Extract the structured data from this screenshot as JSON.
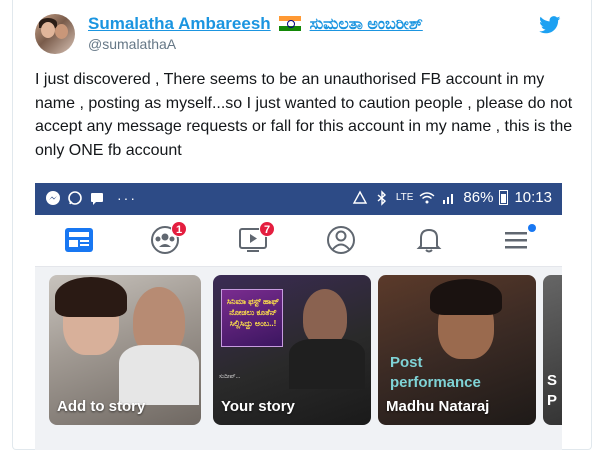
{
  "tweet": {
    "display_name": "Sumalatha Ambareesh",
    "kannada_name": "ಸುಮಲತಾ ಅಂಬರೀಶ್",
    "handle": "@sumalathaA",
    "text": "I just discovered , There seems to be an unauthorised FB account in my name , posting as myself...so I just wanted to caution people , please do not accept any message requests or fall for this account in my name , this is the  only ONE fb account"
  },
  "phone": {
    "status_bar": {
      "dots": "···",
      "network": "LTE",
      "battery_percent": "86%",
      "time": "10:13"
    },
    "nav": {
      "groups_badge": "1",
      "watch_badge": "7"
    },
    "stories": [
      {
        "label": "Add to story"
      },
      {
        "label": "Your story",
        "poster_text": "ಸಿನಿಮಾ ಫಸ್ಟ್ ಹಾಫ್ ನೋಡಲು ಕೂತೆನ್ ಸಿಲ್ಲಿಸಿದ್ದು ಅಂಬ..!",
        "caption": "ಸುದೀಪ್..."
      },
      {
        "label": "Madhu Nataraj",
        "overlay_text": "Post performance"
      },
      {
        "label": "S\nP"
      }
    ]
  },
  "colors": {
    "link_blue": "#1b95e0",
    "status_bar": "#2d4b86",
    "badge_red": "#e41e3f",
    "fb_blue": "#1877f2"
  }
}
